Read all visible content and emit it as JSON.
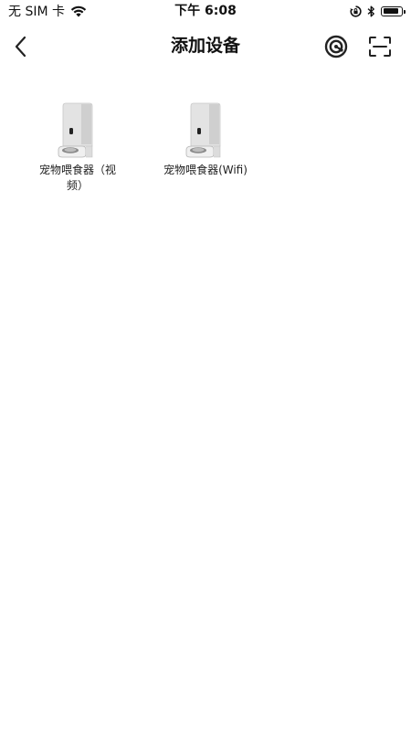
{
  "status_bar": {
    "carrier": "无 SIM 卡",
    "time": "下午 6:08",
    "battery_level": 0.9,
    "icons": [
      "wifi-icon",
      "orientation-lock-icon",
      "bluetooth-icon",
      "battery-icon"
    ]
  },
  "nav": {
    "back_icon": "chevron-left-icon",
    "title": "添加设备",
    "actions": [
      "hotspot-icon",
      "scan-icon"
    ]
  },
  "devices": [
    {
      "label": "宠物喂食器（视频）",
      "icon": "pet-feeder-image"
    },
    {
      "label": "宠物喂食器(Wifi)",
      "icon": "pet-feeder-image"
    }
  ]
}
